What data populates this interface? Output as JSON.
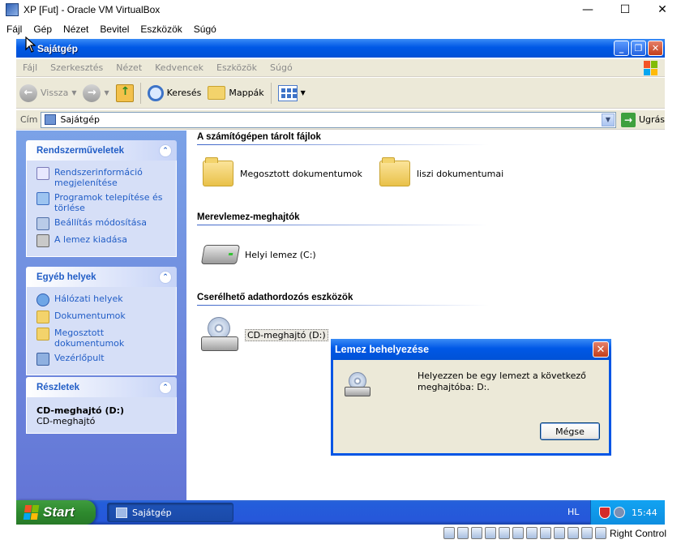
{
  "host": {
    "title": "XP [Fut] - Oracle VM VirtualBox",
    "menu": [
      "Fájl",
      "Gép",
      "Nézet",
      "Bevitel",
      "Eszközök",
      "Súgó"
    ],
    "status_right": "Right Control"
  },
  "explorer": {
    "title": "Sajátgép",
    "menu": [
      "Fájl",
      "Szerkesztés",
      "Nézet",
      "Kedvencek",
      "Eszközök",
      "Súgó"
    ],
    "toolbar": {
      "back": "Vissza",
      "search": "Keresés",
      "folders": "Mappák"
    },
    "address": {
      "label": "Cím",
      "value": "Sajátgép",
      "go": "Ugrás"
    }
  },
  "taskpane": {
    "system": {
      "title": "Rendszerműveletek",
      "items": [
        "Rendszerinformáció megjelenítése",
        "Programok telepítése és törlése",
        "Beállítás módosítása",
        "A lemez kiadása"
      ]
    },
    "other": {
      "title": "Egyéb helyek",
      "items": [
        "Hálózati helyek",
        "Dokumentumok",
        "Megosztott dokumentumok",
        "Vezérlőpult"
      ]
    },
    "details": {
      "title": "Részletek",
      "name": "CD-meghajtó (D:)",
      "type": "CD-meghajtó"
    }
  },
  "content": {
    "groups": [
      {
        "title": "A számítógépen tárolt fájlok",
        "items": [
          "Megosztott dokumentumok",
          "liszi dokumentumai"
        ]
      },
      {
        "title": "Merevlemez-meghajtók",
        "items": [
          "Helyi lemez (C:)"
        ]
      },
      {
        "title": "Cserélhető adathordozós eszközök",
        "items": [
          "CD-meghajtó (D:)"
        ]
      }
    ]
  },
  "dialog": {
    "title": "Lemez behelyezése",
    "message": "Helyezzen be egy lemezt a következő meghajtóba: D:.",
    "cancel": "Mégse"
  },
  "taskbar": {
    "start": "Start",
    "window": "Sajátgép",
    "lang": "HL",
    "clock": "15:44"
  },
  "colors": {
    "xp_blue": "#0058e6",
    "taskpane_link": "#215dc6",
    "start_green": "#2e8a2e"
  }
}
